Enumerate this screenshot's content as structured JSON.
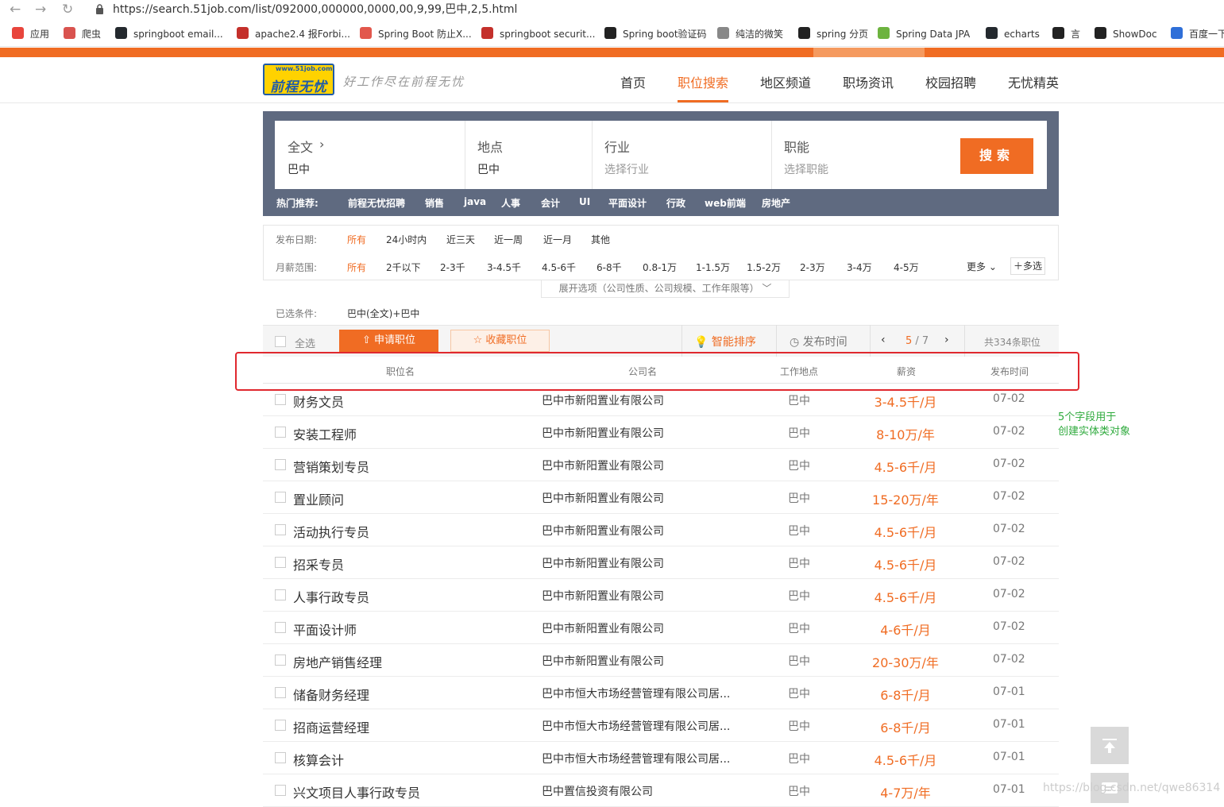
{
  "browser": {
    "url": "https://search.51job.com/list/092000,000000,0000,00,9,99,巴中,2,5.html",
    "bookmarks": [
      "应用",
      "爬虫",
      "springboot email...",
      "apache2.4 报Forbi...",
      "Spring Boot 防止X...",
      "springboot securit...",
      "Spring boot验证码",
      "纯洁的微笑",
      "spring 分页",
      "Spring Data JPA",
      "echarts",
      "言",
      "ShowDoc",
      "百度一下"
    ]
  },
  "header": {
    "logo_small": "www.51job.com",
    "logo_big": "前程无忧",
    "slogan": "好工作尽在前程无忧",
    "nav": [
      "首页",
      "职位搜索",
      "地区频道",
      "职场资讯",
      "校园招聘",
      "无忧精英"
    ],
    "active_nav": "职位搜索"
  },
  "search": {
    "fulltext_label": "全文",
    "fulltext_value": "巴中",
    "location_label": "地点",
    "location_value": "巴中",
    "industry_label": "行业",
    "industry_placeholder": "选择行业",
    "function_label": "职能",
    "function_placeholder": "选择职能",
    "button": "搜索",
    "hot_label": "热门推荐:",
    "hot_items": [
      "前程无忧招聘",
      "销售",
      "java",
      "人事",
      "会计",
      "UI",
      "平面设计",
      "行政",
      "web前端",
      "房地产"
    ]
  },
  "filters": {
    "date_label": "发布日期:",
    "date_options": [
      "所有",
      "24小时内",
      "近三天",
      "近一周",
      "近一月",
      "其他"
    ],
    "salary_label": "月薪范围:",
    "salary_options": [
      "所有",
      "2千以下",
      "2-3千",
      "3-4.5千",
      "4.5-6千",
      "6-8千",
      "0.8-1万",
      "1-1.5万",
      "1.5-2万",
      "2-3万",
      "3-4万",
      "4-5万"
    ],
    "more": "更多",
    "multi": "多选",
    "expand": "展开选项（公司性质、公司规模、工作年限等）",
    "selected_label": "已选条件:",
    "selected_value": "巴中(全文)+巴中"
  },
  "toolbar": {
    "select_all": "全选",
    "apply": "申请职位",
    "favorite": "收藏职位",
    "smart_sort": "智能排序",
    "publish_time": "发布时间",
    "page_current": "5",
    "page_total": "/ 7",
    "total": "共334条职位"
  },
  "table": {
    "headers": [
      "职位名",
      "公司名",
      "工作地点",
      "薪资",
      "发布时间"
    ],
    "rows": [
      {
        "title": "财务文员",
        "company": "巴中市新阳置业有限公司",
        "location": "巴中",
        "salary": "3-4.5千/月",
        "date": "07-02"
      },
      {
        "title": "安装工程师",
        "company": "巴中市新阳置业有限公司",
        "location": "巴中",
        "salary": "8-10万/年",
        "date": "07-02"
      },
      {
        "title": "营销策划专员",
        "company": "巴中市新阳置业有限公司",
        "location": "巴中",
        "salary": "4.5-6千/月",
        "date": "07-02"
      },
      {
        "title": "置业顾问",
        "company": "巴中市新阳置业有限公司",
        "location": "巴中",
        "salary": "15-20万/年",
        "date": "07-02"
      },
      {
        "title": "活动执行专员",
        "company": "巴中市新阳置业有限公司",
        "location": "巴中",
        "salary": "4.5-6千/月",
        "date": "07-02"
      },
      {
        "title": "招采专员",
        "company": "巴中市新阳置业有限公司",
        "location": "巴中",
        "salary": "4.5-6千/月",
        "date": "07-02"
      },
      {
        "title": "人事行政专员",
        "company": "巴中市新阳置业有限公司",
        "location": "巴中",
        "salary": "4.5-6千/月",
        "date": "07-02"
      },
      {
        "title": "平面设计师",
        "company": "巴中市新阳置业有限公司",
        "location": "巴中",
        "salary": "4-6千/月",
        "date": "07-02"
      },
      {
        "title": "房地产销售经理",
        "company": "巴中市新阳置业有限公司",
        "location": "巴中",
        "salary": "20-30万/年",
        "date": "07-02"
      },
      {
        "title": "储备财务经理",
        "company": "巴中市恒大市场经营管理有限公司居...",
        "location": "巴中",
        "salary": "6-8千/月",
        "date": "07-01"
      },
      {
        "title": "招商运营经理",
        "company": "巴中市恒大市场经营管理有限公司居...",
        "location": "巴中",
        "salary": "6-8千/月",
        "date": "07-01"
      },
      {
        "title": "核算会计",
        "company": "巴中市恒大市场经营管理有限公司居...",
        "location": "巴中",
        "salary": "4.5-6千/月",
        "date": "07-01"
      },
      {
        "title": "兴文项目人事行政专员",
        "company": "巴中置信投资有限公司",
        "location": "巴中",
        "salary": "4-7万/年",
        "date": "07-01"
      }
    ]
  },
  "annotation": {
    "line1": "5个字段用于",
    "line2": "创建实体类对象"
  },
  "watermark": "https://blog.csdn.net/qwe86314",
  "colors": {
    "accent": "#f06c23",
    "annotation_box": "#e0282e",
    "annotation_text": "#2eaa3c"
  }
}
